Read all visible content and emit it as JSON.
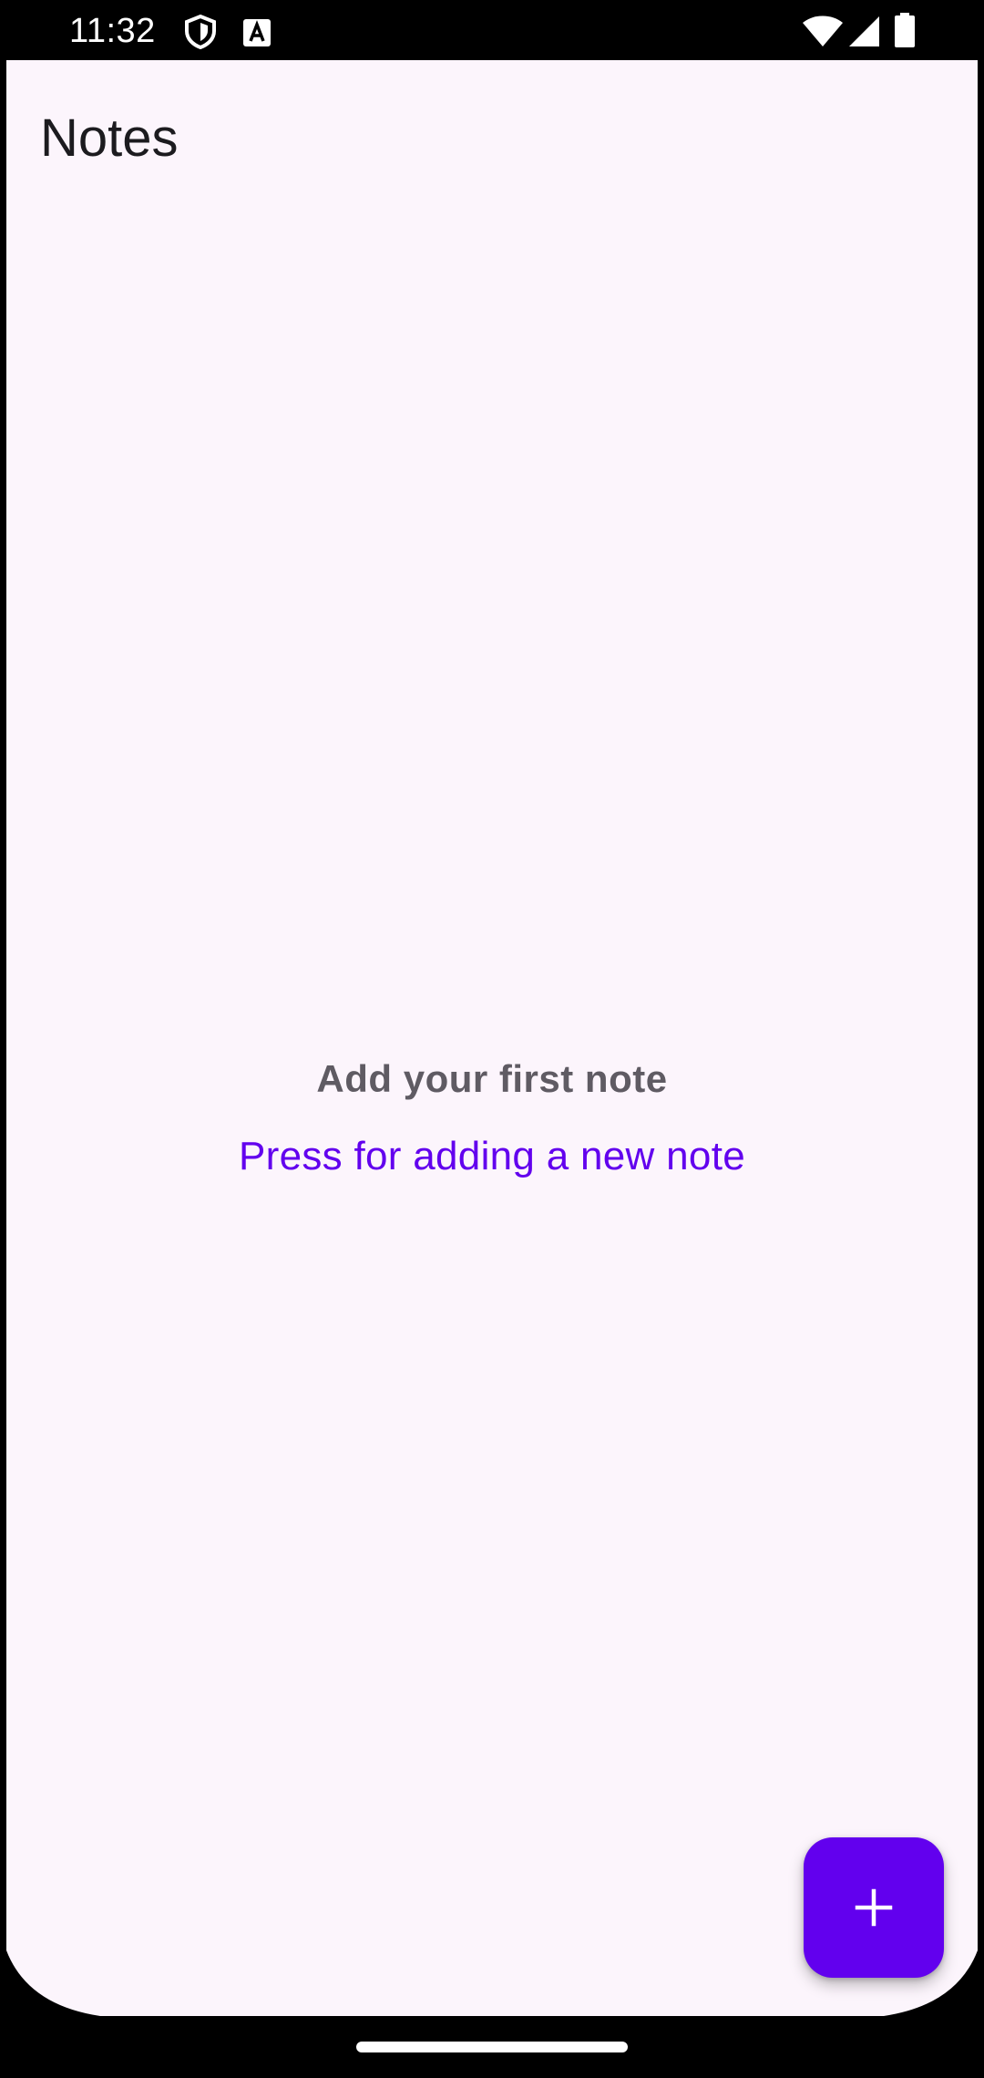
{
  "status_bar": {
    "time": "11:32",
    "icons": [
      "shield-icon",
      "text-a-icon",
      "wifi-icon",
      "cellular-signal-icon",
      "battery-icon"
    ]
  },
  "app_bar": {
    "title": "Notes"
  },
  "empty_state": {
    "title": "Add your first note",
    "action": "Press for adding a new note"
  },
  "fab": {
    "icon": "plus-icon"
  },
  "colors": {
    "background": "#FCF5FC",
    "accent": "#6200EE",
    "title_text": "#1C1B1F",
    "muted_text": "#5F5B63"
  }
}
